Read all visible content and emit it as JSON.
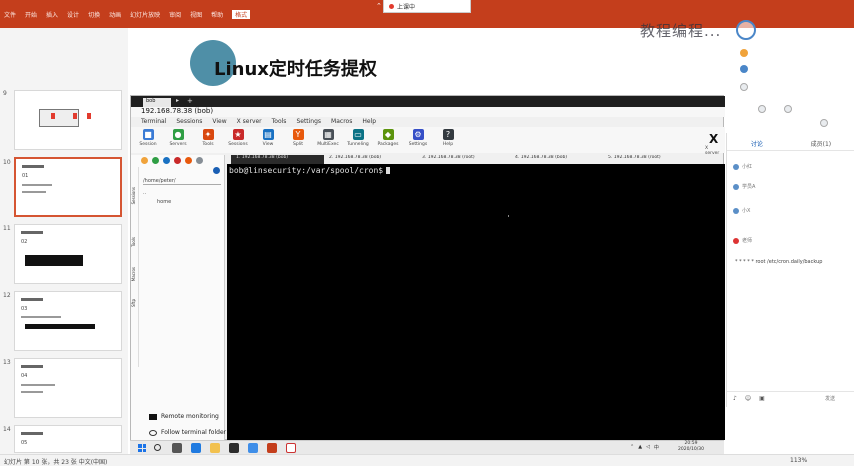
{
  "ribbon": {
    "tabs": [
      "文件",
      "开始",
      "插入",
      "设计",
      "切换",
      "动画",
      "幻灯片放映",
      "审阅",
      "视图",
      "帮助",
      "格式"
    ],
    "active_tab": "格式",
    "meeting_label": "上课中",
    "watermark": "教程编程..."
  },
  "thumbnails": [
    {
      "num": "9",
      "label": ""
    },
    {
      "num": "10",
      "label": "01"
    },
    {
      "num": "11",
      "label": "02"
    },
    {
      "num": "12",
      "label": "03"
    },
    {
      "num": "13",
      "label": "04"
    },
    {
      "num": "14",
      "label": "05"
    }
  ],
  "slide": {
    "title": "Linux定时任务提权"
  },
  "xshell": {
    "tab_label": "bob",
    "address": "192.168.78.38 (bob)",
    "menu": [
      "Terminal",
      "Sessions",
      "View",
      "X server",
      "Tools",
      "Settings",
      "Macros",
      "Help"
    ],
    "toolbar": [
      {
        "label": "Session",
        "icon": "session-icon",
        "color": "#3a7bd5"
      },
      {
        "label": "Servers",
        "icon": "servers-icon",
        "color": "#2f9e44"
      },
      {
        "label": "Tools",
        "icon": "tools-icon",
        "color": "#d9480f"
      },
      {
        "label": "Sessions",
        "icon": "sessions-icon",
        "color": "#c92a2a"
      },
      {
        "label": "View",
        "icon": "view-icon",
        "color": "#1971c2"
      },
      {
        "label": "Split",
        "icon": "split-icon",
        "color": "#e8590c"
      },
      {
        "label": "MultiExec",
        "icon": "multiexec-icon",
        "color": "#495057"
      },
      {
        "label": "Tunneling",
        "icon": "tunneling-icon",
        "color": "#0b7285"
      },
      {
        "label": "Packages",
        "icon": "packages-icon",
        "color": "#5c940d"
      },
      {
        "label": "Settings",
        "icon": "settings-icon",
        "color": "#364fc7"
      },
      {
        "label": "Help",
        "icon": "help-icon",
        "color": "#343a40"
      }
    ],
    "x_server_label": "X server",
    "session_tabs": [
      "1. 192.168.78.38 (bob)",
      "2. 192.168.78.38 (bob)",
      "3. 192.168.78.38 (root)",
      "4. 192.168.78.38 (bob)",
      "5. 192.168.78.38 (root)"
    ],
    "sidebar": {
      "path": "/home/peter/",
      "up_item": "..",
      "folder_item": "home",
      "strip": [
        "Sessions",
        "Tools",
        "Macros",
        "Sftp"
      ],
      "remote_monitoring": "Remote monitoring",
      "follow_folder": "Follow terminal folder"
    },
    "terminal": {
      "prompt": "bob@linsecurity:/var/spool/cron$"
    }
  },
  "chat": {
    "tabs": [
      "讨论",
      "成员(1)"
    ],
    "messages": [
      "小红",
      "学员A",
      "小X",
      "老师"
    ],
    "message_text": "* * * * * root /etc/cron.daily/backup",
    "send_label": "发送"
  },
  "taskbar": {
    "time": "20:59",
    "date": "2020/10/30",
    "lang": "中"
  },
  "statusbar": {
    "left": "幻灯片 第 10 张，共 23 张   中文(中国)",
    "zoom": "113%"
  }
}
